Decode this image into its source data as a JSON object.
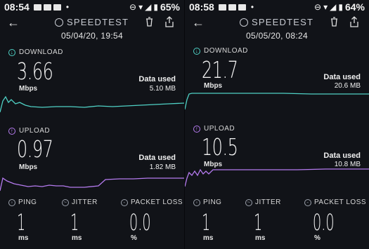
{
  "panels": [
    {
      "status": {
        "time": "08:54",
        "battery": "65%"
      },
      "title": "SPEEDTEST",
      "timestamp": "05/04/20, 19:54",
      "download": {
        "label": "DOWNLOAD",
        "value": "3.66",
        "unit": "Mbps",
        "used_label": "Data used",
        "used_value": "5.10 MB"
      },
      "upload": {
        "label": "UPLOAD",
        "value": "0.97",
        "unit": "Mbps",
        "used_label": "Data used",
        "used_value": "1.82 MB"
      },
      "ping": {
        "label": "PING",
        "value": "1",
        "unit": "ms"
      },
      "jitter": {
        "label": "JITTER",
        "value": "1",
        "unit": "ms"
      },
      "loss": {
        "label": "PACKET LOSS",
        "value": "0.0",
        "unit": "%"
      }
    },
    {
      "status": {
        "time": "08:58",
        "battery": "64%"
      },
      "title": "SPEEDTEST",
      "timestamp": "05/05/20, 08:24",
      "download": {
        "label": "DOWNLOAD",
        "value": "21.7",
        "unit": "Mbps",
        "used_label": "Data used",
        "used_value": "20.6 MB"
      },
      "upload": {
        "label": "UPLOAD",
        "value": "10.5",
        "unit": "Mbps",
        "used_label": "Data used",
        "used_value": "10.8 MB"
      },
      "ping": {
        "label": "PING",
        "value": "1",
        "unit": "ms"
      },
      "jitter": {
        "label": "JITTER",
        "value": "1",
        "unit": "ms"
      },
      "loss": {
        "label": "PACKET LOSS",
        "value": "0.0",
        "unit": "%"
      }
    }
  ],
  "colors": {
    "download": "#4fd1c5",
    "upload": "#b57bef",
    "background": "#111318"
  },
  "icons": [
    "back-arrow-icon",
    "speedometer-icon",
    "trash-icon",
    "share-icon",
    "download-icon",
    "upload-icon",
    "ping-icon",
    "jitter-icon",
    "packet-loss-icon"
  ]
}
